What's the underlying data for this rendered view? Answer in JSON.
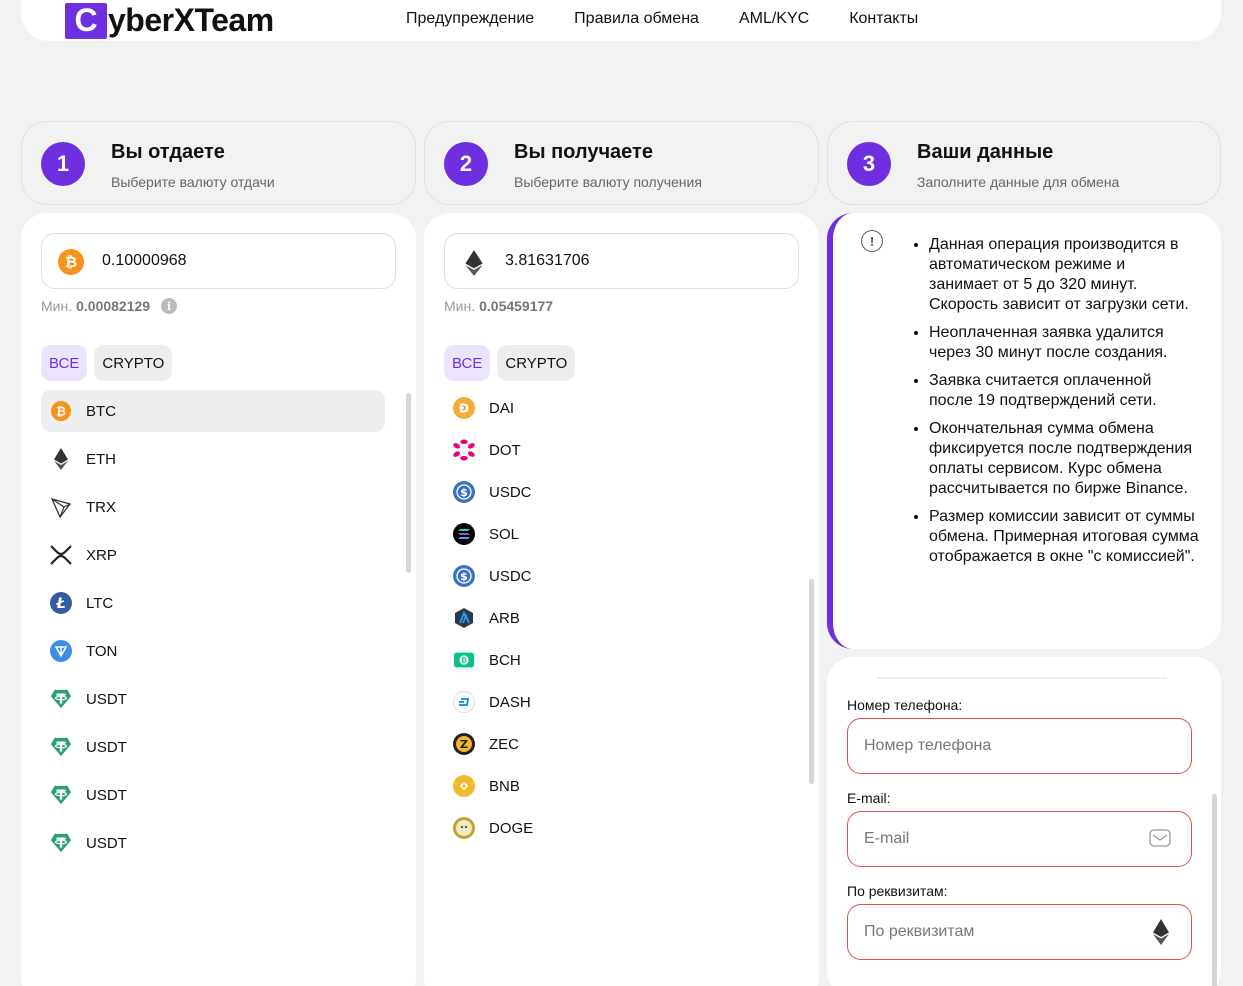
{
  "header": {
    "logo_letter": "C",
    "logo_rest": "yberXTeam",
    "nav": [
      "Предупреждение",
      "Правила обмена",
      "AML/KYC",
      "Контакты"
    ]
  },
  "steps": [
    {
      "num": "1",
      "title": "Вы отдаете",
      "subtitle": "Выберите валюту отдачи"
    },
    {
      "num": "2",
      "title": "Вы получаете",
      "subtitle": "Выберите валюту получения"
    },
    {
      "num": "3",
      "title": "Ваши данные",
      "subtitle": "Заполните данные для обмена"
    }
  ],
  "give": {
    "amount": "0.10000968",
    "min_label": "Мин.",
    "min_value": "0.00082129",
    "filters": [
      "ВСЕ",
      "CRYPTO"
    ],
    "coins": [
      "BTC",
      "ETH",
      "TRX",
      "XRP",
      "LTC",
      "TON",
      "USDT",
      "USDT",
      "USDT",
      "USDT"
    ]
  },
  "get": {
    "amount": "3.81631706",
    "min_label": "Мин.",
    "min_value": "0.05459177",
    "filters": [
      "ВСЕ",
      "CRYPTO"
    ],
    "coins": [
      "DAI",
      "DOT",
      "USDC",
      "SOL",
      "USDC",
      "ARB",
      "BCH",
      "DASH",
      "ZEC",
      "BNB",
      "DOGE"
    ]
  },
  "rules": [
    "Данная операция производится в автоматическом режиме и занимает от 5 до 320 минут. Скорость зависит от загрузки сети.",
    "Неоплаченная заявка удалится через 30 минут после создания.",
    "Заявка считается оплаченной после 19 подтверждений сети.",
    "Окончательная сумма обмена фиксируется после подтверждения оплаты сервисом. Курс обмена рассчитывается по бирже Binance.",
    "Размер комиссии зависит от суммы обмена. Примерная итоговая сумма отображается в окне \"с комиссией\"."
  ],
  "form": {
    "phone_label": "Номер телефона:",
    "phone_placeholder": "Номер телефона",
    "email_label": "E-mail:",
    "email_placeholder": "E-mail",
    "req_label": "По реквизитам:",
    "req_placeholder": "По реквизитам"
  },
  "colors": {
    "accent": "#6d2fe0",
    "error": "#e25050",
    "btc": "#f7931a"
  }
}
